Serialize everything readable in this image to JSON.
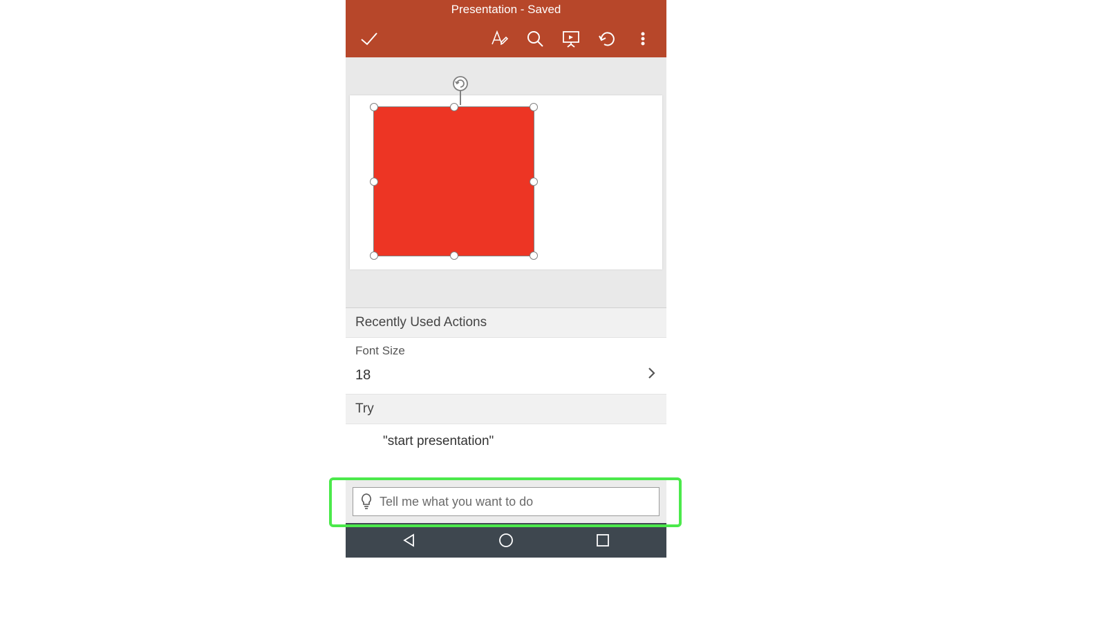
{
  "header": {
    "title": "Presentation - Saved"
  },
  "toolbar": {
    "done_label": "Done",
    "edit_label": "Edit",
    "search_label": "Search",
    "present_label": "Present",
    "undo_label": "Undo",
    "more_label": "More"
  },
  "slide": {
    "shape": {
      "type": "rectangle",
      "fill": "#ed3524",
      "selected": true
    }
  },
  "panel": {
    "recent_header": "Recently Used Actions",
    "font_size_label": "Font Size",
    "font_size_value": "18",
    "try_header": "Try",
    "try_suggestion": "\"start presentation\""
  },
  "search": {
    "placeholder": "Tell me what you want to do",
    "value": ""
  },
  "nav": {
    "back": "Back",
    "home": "Home",
    "recent": "Recent"
  },
  "colors": {
    "brand": "#b7472a",
    "shape_fill": "#ed3524",
    "highlight": "#4be94b"
  }
}
